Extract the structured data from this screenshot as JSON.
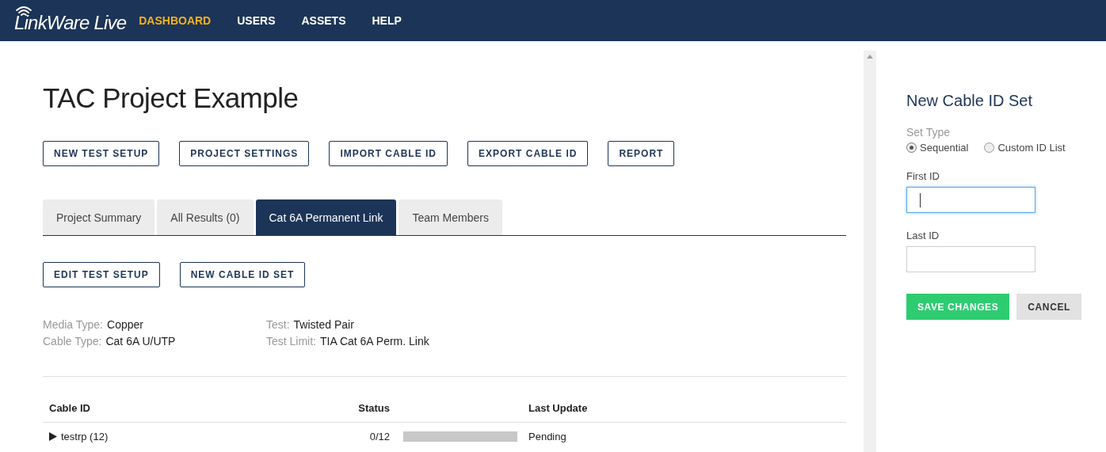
{
  "header": {
    "logo": "LinkWare Live",
    "nav": [
      {
        "label": "DASHBOARD",
        "selected": true
      },
      {
        "label": "USERS",
        "selected": false
      },
      {
        "label": "ASSETS",
        "selected": false
      },
      {
        "label": "HELP",
        "selected": false
      }
    ]
  },
  "project": {
    "title": "TAC Project Example",
    "actions": [
      "NEW TEST SETUP",
      "PROJECT SETTINGS",
      "IMPORT CABLE ID",
      "EXPORT CABLE ID",
      "REPORT"
    ],
    "tabs": [
      {
        "label": "Project Summary",
        "selected": false
      },
      {
        "label": "All Results (0)",
        "selected": false
      },
      {
        "label": "Cat 6A Permanent Link",
        "selected": true
      },
      {
        "label": "Team Members",
        "selected": false
      }
    ],
    "tab_actions": [
      "EDIT TEST SETUP",
      "NEW CABLE ID SET"
    ],
    "details": [
      [
        {
          "label": "Media Type:",
          "value": "Copper"
        },
        {
          "label": "Cable Type:",
          "value": "Cat 6A U/UTP"
        }
      ],
      [
        {
          "label": "Test:",
          "value": "Twisted Pair"
        },
        {
          "label": "Test Limit:",
          "value": "TIA Cat 6A Perm. Link"
        }
      ]
    ],
    "table": {
      "columns": [
        "Cable ID",
        "Status",
        "Last Update"
      ],
      "rows": [
        {
          "cable_id": "testrp (12)",
          "expanded": false,
          "count": "0/12",
          "level": 0,
          "last_update": "Pending"
        }
      ]
    }
  },
  "panel": {
    "title": "New Cable ID Set",
    "set_type_label": "Set Type",
    "options": [
      {
        "label": "Sequential",
        "selected": true
      },
      {
        "label": "Custom ID List",
        "selected": false
      }
    ],
    "fields": [
      {
        "label": "First ID",
        "focused": true
      },
      {
        "label": "Last ID",
        "focused": false
      }
    ],
    "buttons": [
      {
        "label": "SAVE CHANGES",
        "kind": "primary"
      },
      {
        "label": "CANCEL",
        "kind": "secondary"
      }
    ]
  }
}
